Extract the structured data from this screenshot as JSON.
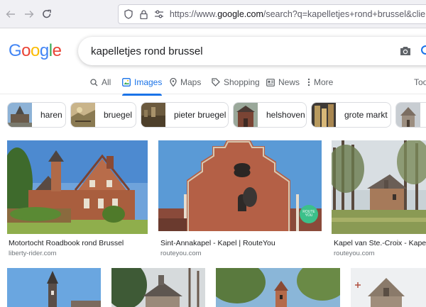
{
  "browser": {
    "url_prefix": "https://www.",
    "url_domain": "google.com",
    "url_rest": "/search?q=kapelletjes+rond+brussel&client=firefox"
  },
  "logo": {
    "letters": [
      "G",
      "o",
      "o",
      "g",
      "l",
      "e"
    ],
    "colors": [
      "#4285F4",
      "#EA4335",
      "#FBBC05",
      "#4285F4",
      "#34A853",
      "#EA4335"
    ]
  },
  "search": {
    "query": "kapelletjes rond brussel"
  },
  "tabs": [
    {
      "label": "All",
      "icon": "search-icon"
    },
    {
      "label": "Images",
      "icon": "image-icon",
      "active": true
    },
    {
      "label": "Maps",
      "icon": "map-pin-icon"
    },
    {
      "label": "Shopping",
      "icon": "tag-icon"
    },
    {
      "label": "News",
      "icon": "news-icon"
    },
    {
      "label": "More",
      "icon": "more-vert-icon"
    },
    {
      "label": "Too"
    }
  ],
  "chips": [
    {
      "label": "haren"
    },
    {
      "label": "bruegel"
    },
    {
      "label": "pieter bruegel"
    },
    {
      "label": "helshoven"
    },
    {
      "label": "grote markt"
    }
  ],
  "results": [
    {
      "title": "Motortocht Roadbook rond Brussel",
      "source": "liberty-rider.com"
    },
    {
      "title": "Sint-Annakapel - Kapel | RouteYou",
      "source": "routeyou.com"
    },
    {
      "title": "Kapel van Ste.-Croix - Kapel | Rout",
      "source": "routeyou.com"
    }
  ],
  "badge": {
    "line1": "ROUTE",
    "line2": "YOU"
  },
  "colors": {
    "accent": "#1a73e8",
    "brick": "#a55a3e",
    "sky": "#5a9ad6"
  }
}
